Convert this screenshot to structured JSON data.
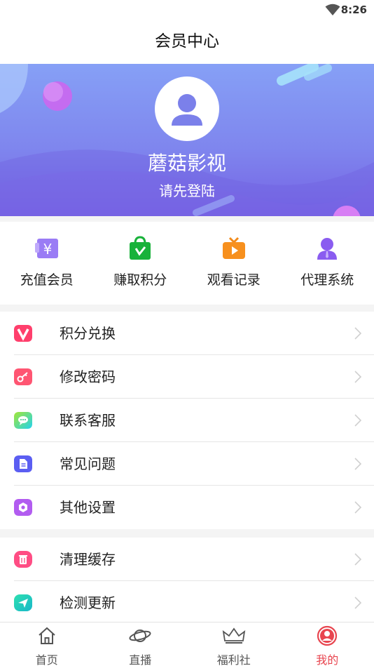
{
  "status_bar": {
    "time": "8:26"
  },
  "header": {
    "title": "会员中心"
  },
  "profile": {
    "app_name": "蘑菇影视",
    "login_prompt": "请先登陆"
  },
  "quick_actions": [
    {
      "label": "充值会员",
      "icon": "yen-card-icon"
    },
    {
      "label": "赚取积分",
      "icon": "shopping-bag-icon"
    },
    {
      "label": "观看记录",
      "icon": "tv-icon"
    },
    {
      "label": "代理系统",
      "icon": "agent-person-icon"
    }
  ],
  "menu_group_1": [
    {
      "label": "积分兑换",
      "icon": "v-logo-icon"
    },
    {
      "label": "修改密码",
      "icon": "key-icon"
    },
    {
      "label": "联系客服",
      "icon": "chat-bubble-icon"
    },
    {
      "label": "常见问题",
      "icon": "document-icon"
    },
    {
      "label": "其他设置",
      "icon": "gear-icon"
    }
  ],
  "menu_group_2": [
    {
      "label": "清理缓存",
      "icon": "trash-icon"
    },
    {
      "label": "检测更新",
      "icon": "send-icon"
    }
  ],
  "tabbar": [
    {
      "label": "首页",
      "icon": "home-icon"
    },
    {
      "label": "直播",
      "icon": "planet-icon"
    },
    {
      "label": "福利社",
      "icon": "crown-icon"
    },
    {
      "label": "我的",
      "icon": "user-circle-icon",
      "active": true
    }
  ],
  "colors": {
    "accent": "#e8454f",
    "hero_top": "#86a0f6",
    "hero_bottom": "#7562e4"
  }
}
